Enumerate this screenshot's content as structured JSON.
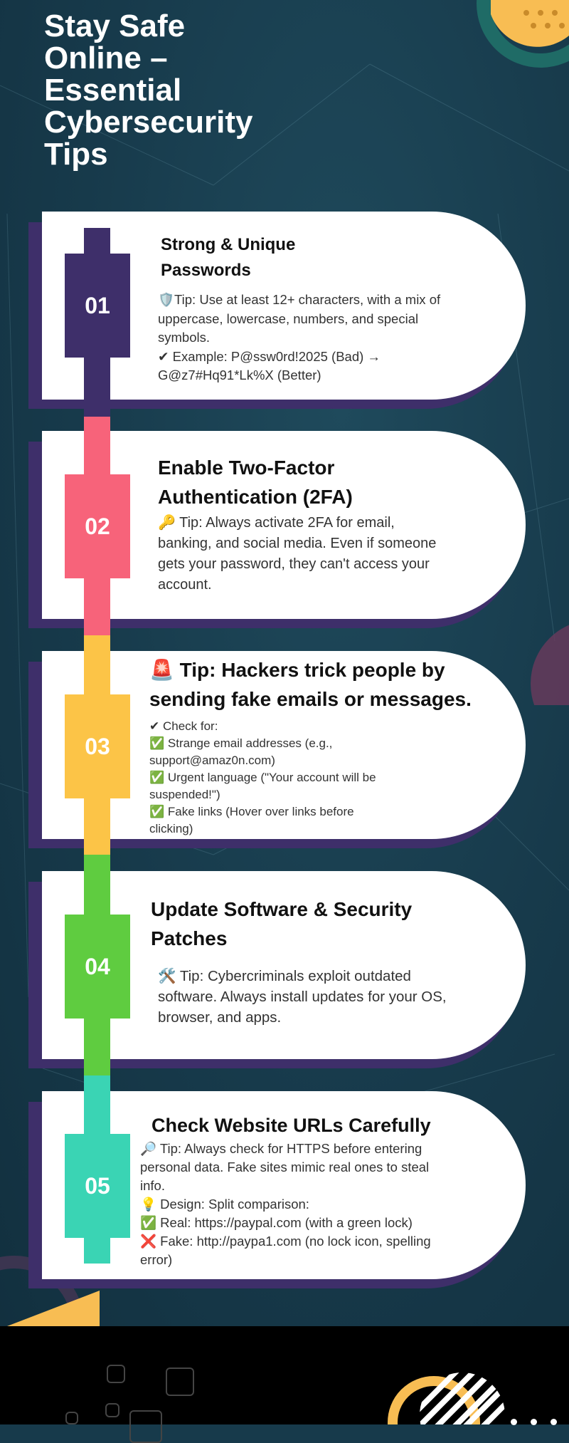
{
  "page": {
    "title_lines": [
      "Stay Safe",
      "Online –",
      "Essential",
      "Cybersecurity",
      "Tips"
    ]
  },
  "colors": {
    "background": "#173a4b",
    "card_shadow": "#3e2f6a",
    "tip1": "#3e2f6a",
    "tip2": "#f7637a",
    "tip3": "#fcc447",
    "tip4": "#5fcc40",
    "tip5": "#3ad4b4",
    "footer": "#000000"
  },
  "tips": [
    {
      "number": "01",
      "heading_lines": [
        "Strong & Unique",
        "Passwords"
      ],
      "body_lines": [
        "🛡️Tip: Use at least 12+ characters, with a mix of",
        "uppercase, lowercase, numbers, and special",
        "symbols.",
        "✔ Example: P@ssw0rd!2025 (Bad) →",
        "G@z7#Hq91*Lk%X (Better)"
      ]
    },
    {
      "number": "02",
      "heading_lines": [
        "Enable Two-Factor",
        "Authentication (2FA)"
      ],
      "body_lines": [
        "🔑 Tip: Always activate 2FA for email,",
        "banking, and social media. Even if someone",
        "gets your password, they can't access your",
        "account."
      ]
    },
    {
      "number": "03",
      "heading_lines": [
        "🚨 Tip: Hackers trick people by",
        "sending fake emails or messages."
      ],
      "body_lines": [
        "✔ Check for:",
        "✅ Strange email addresses (e.g.,",
        "support@amaz0n.com)",
        "✅ Urgent language (\"Your account will be",
        "suspended!\")",
        "✅ Fake links (Hover over links before",
        "clicking)"
      ]
    },
    {
      "number": "04",
      "heading_lines": [
        "Update Software & Security",
        "Patches"
      ],
      "body_lines": [
        "🛠️ Tip: Cybercriminals exploit outdated",
        "software. Always install updates for your OS,",
        "browser, and apps."
      ]
    },
    {
      "number": "05",
      "heading_lines": [
        "Check Website URLs Carefully"
      ],
      "body_lines": [
        "🔎 Tip: Always check for HTTPS before entering",
        "personal data. Fake sites mimic real ones to steal",
        "info.",
        "💡 Design: Split comparison:",
        "✅ Real: https://paypal.com (with a green lock)",
        "❌ Fake: http://paypa1.com (no lock icon, spelling",
        "error)"
      ]
    }
  ]
}
